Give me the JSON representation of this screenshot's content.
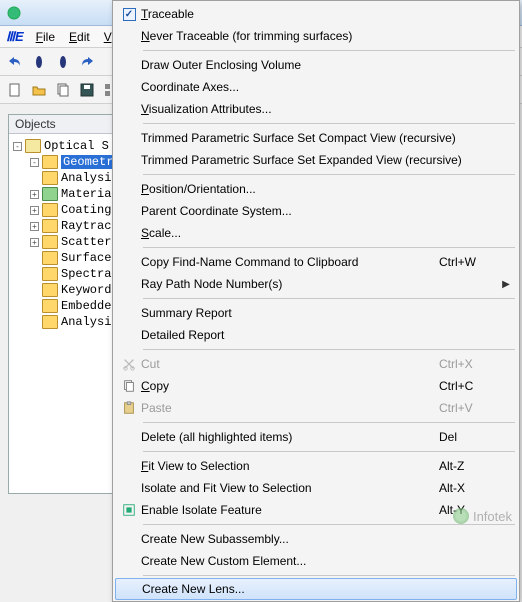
{
  "menubar": {
    "file": "File",
    "edit": "Edit",
    "view": "View"
  },
  "panel": {
    "title": "Objects",
    "items": [
      {
        "label": "Optical S",
        "expand": "-",
        "root": true
      },
      {
        "label": "Geometry",
        "expand": "-",
        "selected": true
      },
      {
        "label": "Analysis",
        "expand": ""
      },
      {
        "label": "Materials",
        "expand": "+"
      },
      {
        "label": "Coatings",
        "expand": "+"
      },
      {
        "label": "Raytrace",
        "expand": "+"
      },
      {
        "label": "Scatterer",
        "expand": "+"
      },
      {
        "label": "Surface R",
        "expand": ""
      },
      {
        "label": "Spectra",
        "expand": ""
      },
      {
        "label": "Keywords",
        "expand": ""
      },
      {
        "label": "Embedded",
        "expand": ""
      },
      {
        "label": "Analysis",
        "expand": ""
      }
    ]
  },
  "menu": {
    "traceable": "Traceable",
    "never_traceable": "Never Traceable (for trimming surfaces)",
    "draw_outer": "Draw Outer Enclosing Volume",
    "coord_axes": "Coordinate Axes...",
    "vis_attr": "Visualization Attributes...",
    "trimmed_compact": "Trimmed Parametric Surface Set Compact View (recursive)",
    "trimmed_expanded": "Trimmed Parametric Surface Set Expanded View (recursive)",
    "position": "Position/Orientation...",
    "parent_coord": "Parent Coordinate System...",
    "scale": "Scale...",
    "copy_findname": "Copy Find-Name Command to Clipboard",
    "copy_findname_sc": "Ctrl+W",
    "ray_path": "Ray Path Node Number(s)",
    "summary": "Summary Report",
    "detailed": "Detailed Report",
    "cut": "Cut",
    "cut_sc": "Ctrl+X",
    "copy": "Copy",
    "copy_sc": "Ctrl+C",
    "paste": "Paste",
    "paste_sc": "Ctrl+V",
    "delete": "Delete (all highlighted items)",
    "delete_sc": "Del",
    "fit_view": "Fit View to Selection",
    "fit_view_sc": "Alt-Z",
    "isolate_fit": "Isolate and Fit View to Selection",
    "isolate_fit_sc": "Alt-X",
    "enable_isolate": "Enable Isolate Feature",
    "enable_isolate_sc": "Alt-Y",
    "create_subasm": "Create New Subassembly...",
    "create_custom": "Create New Custom Element...",
    "create_lens": "Create New Lens..."
  },
  "watermark": "Infotek"
}
